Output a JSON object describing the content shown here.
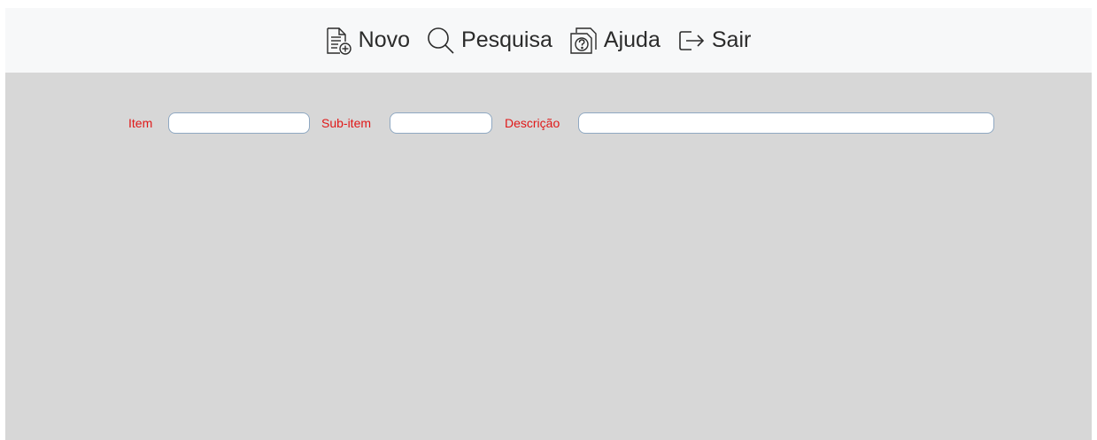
{
  "toolbar": {
    "buttons": [
      {
        "label": "Novo",
        "icon": "new-document-icon"
      },
      {
        "label": "Pesquisa",
        "icon": "search-icon"
      },
      {
        "label": "Ajuda",
        "icon": "help-icon"
      },
      {
        "label": "Sair",
        "icon": "exit-icon"
      }
    ]
  },
  "filters": {
    "item_label": "Item",
    "item_value": "",
    "subitem_label": "Sub-item",
    "subitem_value": "",
    "descricao_label": "Descrição",
    "descricao_value": ""
  },
  "colors": {
    "label": "#e01818",
    "toolbar_bg": "#f7f8f9",
    "content_bg": "#d7d7d7",
    "input_border": "#8fa8c2"
  }
}
